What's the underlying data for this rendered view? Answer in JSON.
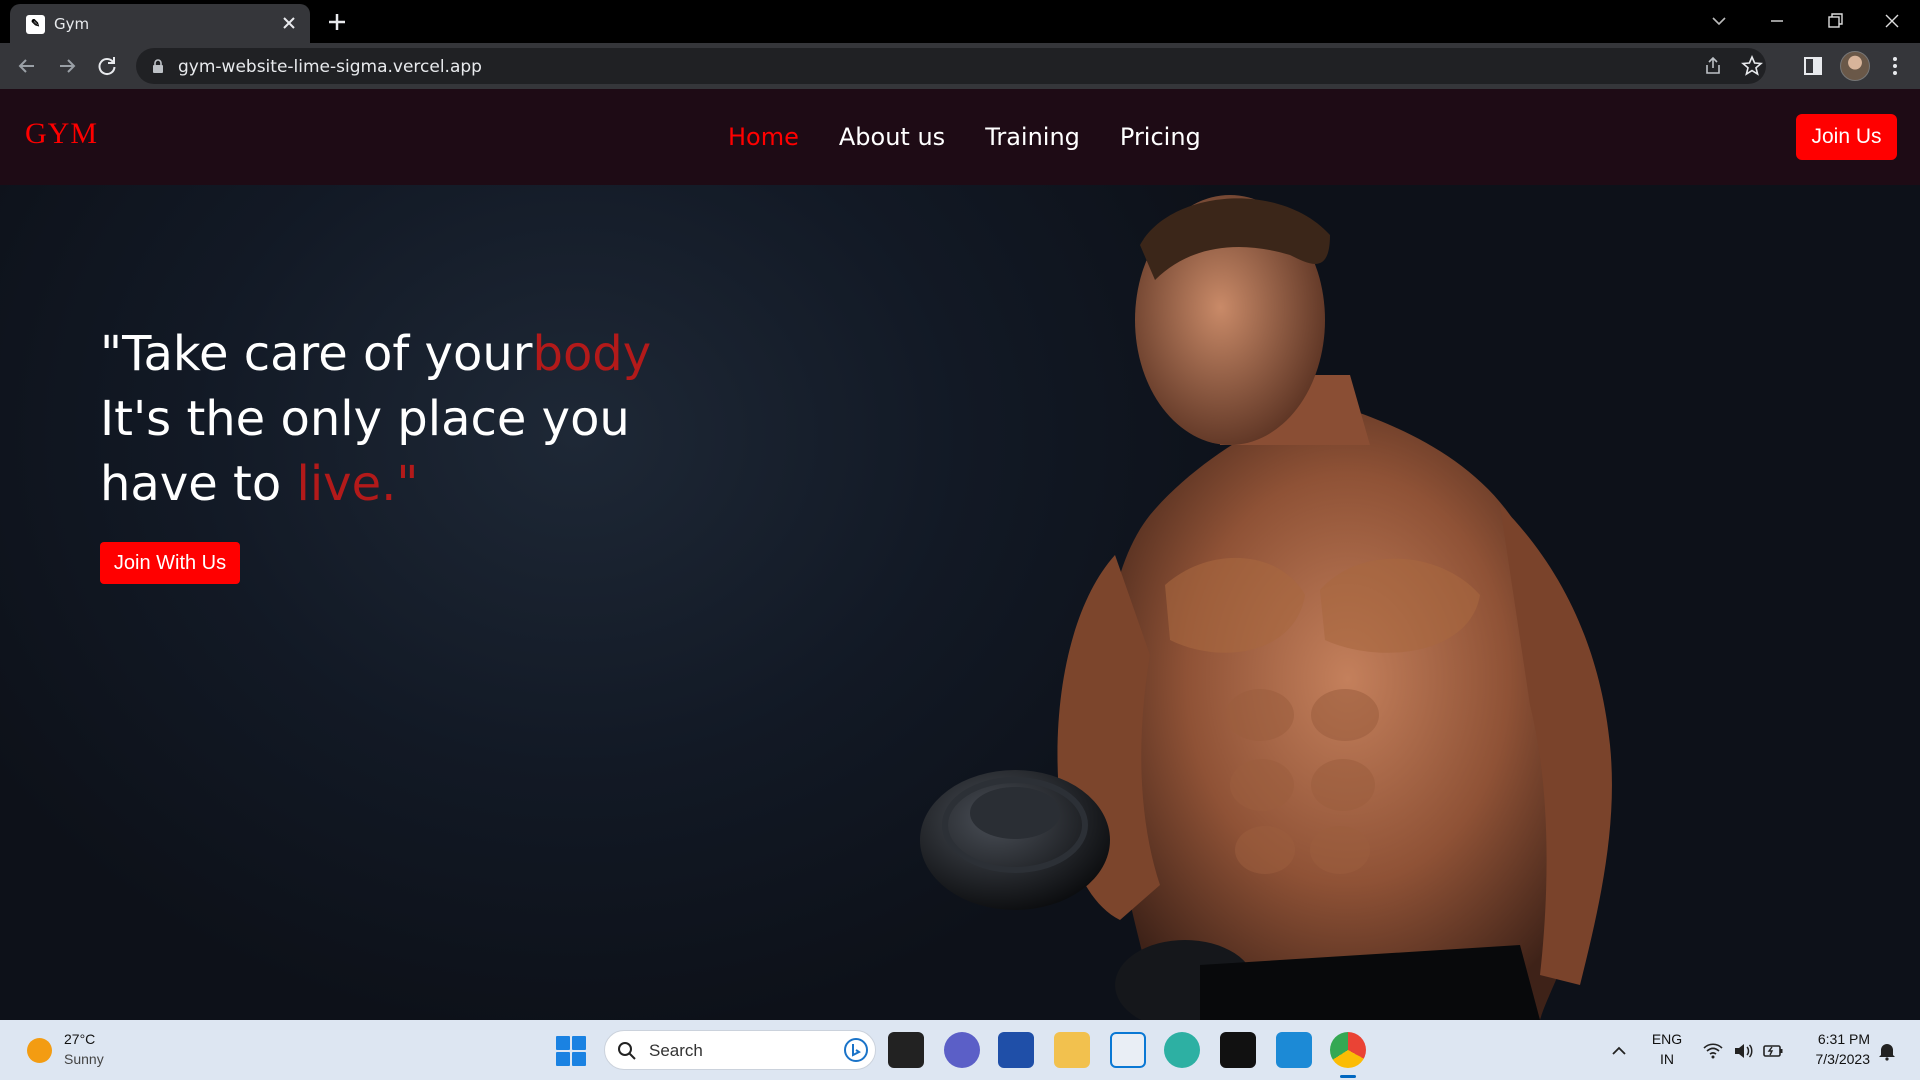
{
  "browser": {
    "tab_title": "Gym",
    "url": "gym-website-lime-sigma.vercel.app"
  },
  "site": {
    "logo": "GYM",
    "nav": [
      {
        "label": "Home",
        "active": true
      },
      {
        "label": "About us",
        "active": false
      },
      {
        "label": "Training",
        "active": false
      },
      {
        "label": "Pricing",
        "active": false
      }
    ],
    "join_button": "Join Us",
    "hero": {
      "line1_start": "\"Take care of your",
      "line1_accent": "body",
      "line2": "It's the only place you",
      "line3_start": "have to ",
      "line3_accent": "live.\"",
      "cta": "Join With Us"
    },
    "colors": {
      "accent": "#ff0000",
      "nav_bg": "#1e0b15",
      "hero_bg": "#121925"
    }
  },
  "taskbar": {
    "weather_temp": "27°C",
    "weather_condition": "Sunny",
    "search_placeholder": "Search",
    "lang_line1": "ENG",
    "lang_line2": "IN",
    "time": "6:31 PM",
    "date": "7/3/2023"
  }
}
